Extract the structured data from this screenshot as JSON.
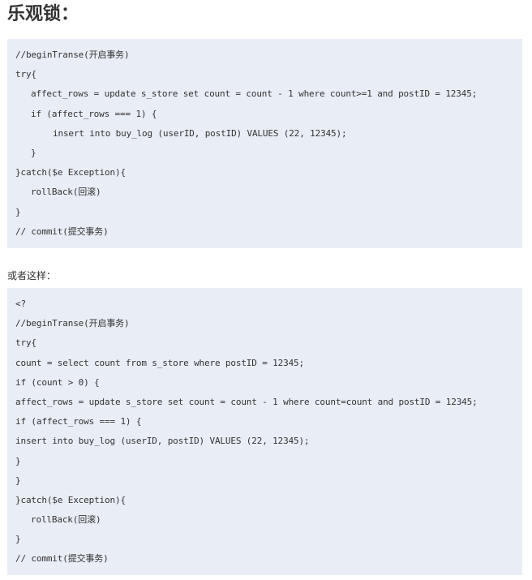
{
  "heading": "乐观锁：",
  "code_block_1": {
    "lines": [
      {
        "text": "//beginTranse(开启事务)",
        "indent": 0
      },
      {
        "text": "try{",
        "indent": 0
      },
      {
        "text": "affect_rows = update s_store set count = count - 1 where count>=1 and postID = 12345;",
        "indent": 1
      },
      {
        "text": "if (affect_rows === 1) {",
        "indent": 1
      },
      {
        "text": "insert into buy_log (userID, postID) VALUES (22, 12345);",
        "indent": 2
      },
      {
        "text": "}",
        "indent": 1
      },
      {
        "text": "}catch($e Exception){",
        "indent": 0
      },
      {
        "text": "rollBack(回滚)",
        "indent": 1
      },
      {
        "text": "}",
        "indent": 0
      },
      {
        "text": "// commit(提交事务)",
        "indent": 0
      }
    ]
  },
  "paragraph": "或者这样：",
  "code_block_2": {
    "lines": [
      {
        "text": "<?",
        "indent": 0
      },
      {
        "text": "//beginTranse(开启事务)",
        "indent": 0
      },
      {
        "text": "try{",
        "indent": 0
      },
      {
        "text": "count = select count from s_store where postID = 12345;",
        "indent": 0
      },
      {
        "text": "if (count > 0) {",
        "indent": 0
      },
      {
        "text": "affect_rows = update s_store set count = count - 1 where count=count and postID = 12345;",
        "indent": 0
      },
      {
        "text": "if (affect_rows === 1) {",
        "indent": 0
      },
      {
        "text": "insert into buy_log (userID, postID) VALUES (22, 12345);",
        "indent": 0
      },
      {
        "text": "}",
        "indent": 0
      },
      {
        "text": "}",
        "indent": 0
      },
      {
        "text": "}catch($e Exception){",
        "indent": 0
      },
      {
        "text": "rollBack(回滚)",
        "indent": 1
      },
      {
        "text": "}",
        "indent": 0
      },
      {
        "text": "// commit(提交事务)",
        "indent": 0
      }
    ]
  },
  "colors": {
    "code_background": "#e9edf5",
    "text": "#333333"
  }
}
